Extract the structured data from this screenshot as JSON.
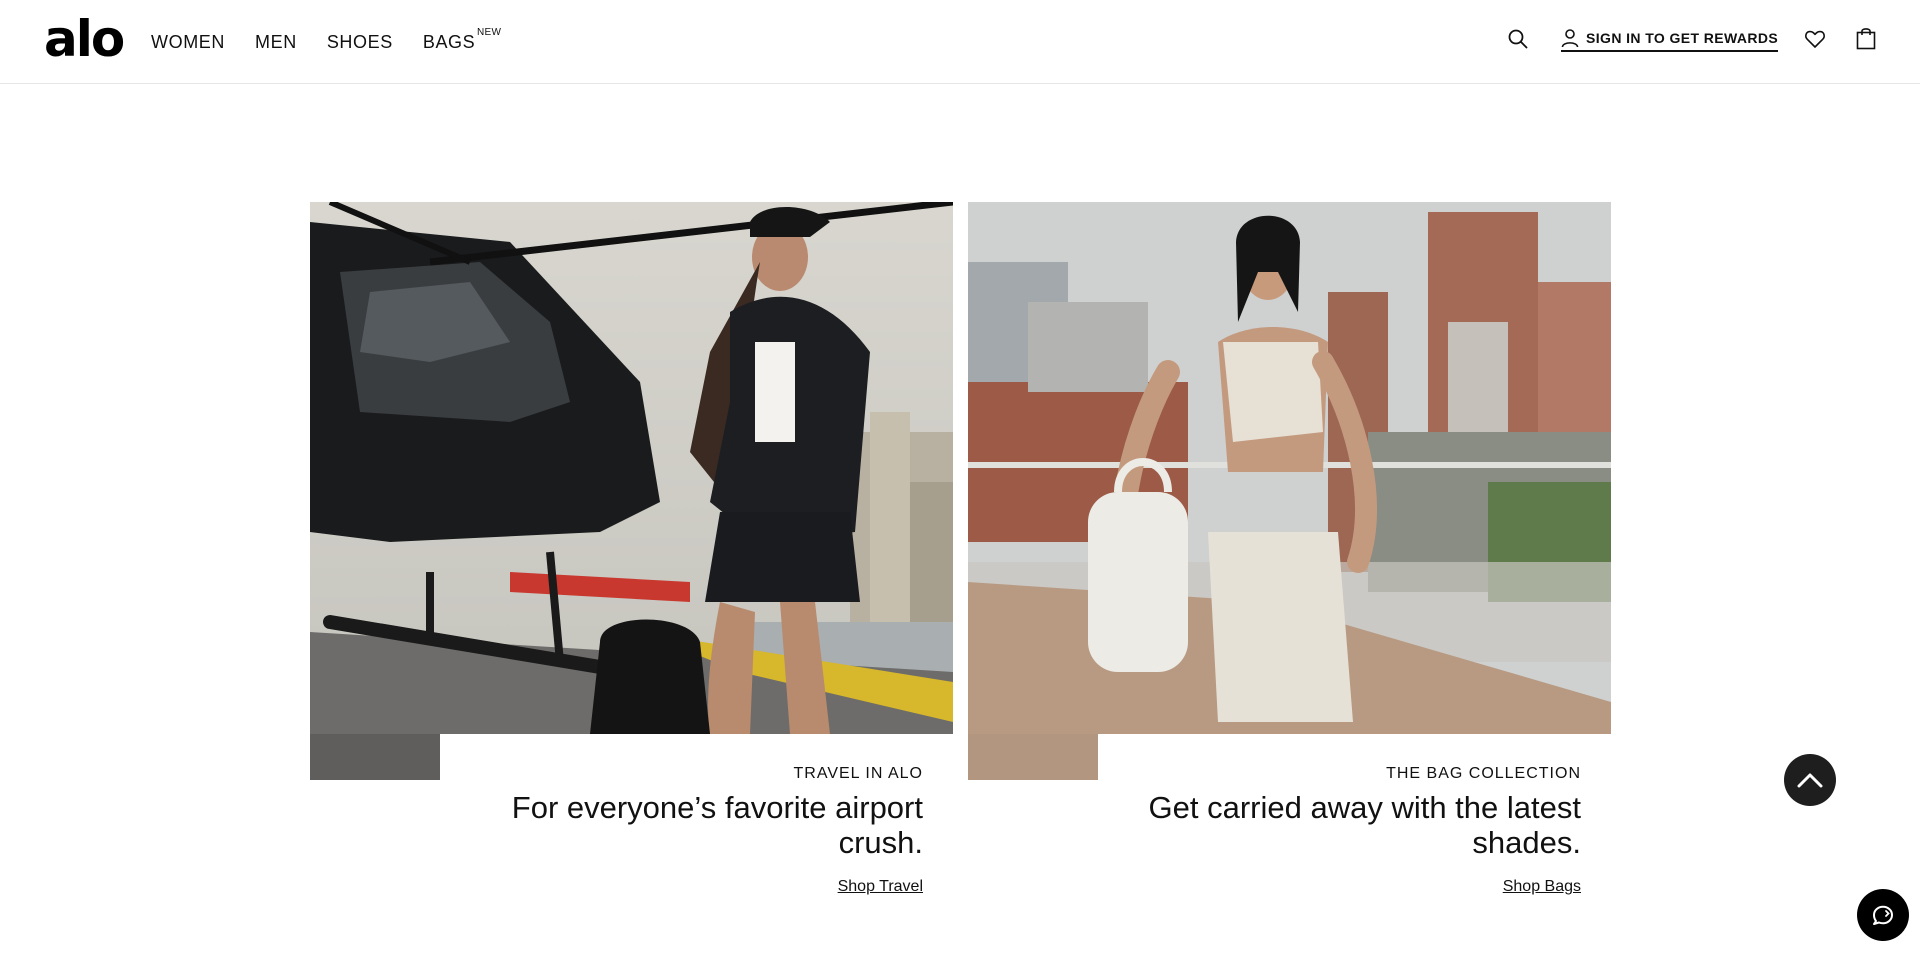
{
  "header": {
    "logo": "alo",
    "nav": [
      {
        "label": "WOMEN"
      },
      {
        "label": "MEN"
      },
      {
        "label": "SHOES"
      },
      {
        "label": "BAGS",
        "badge": "NEW"
      }
    ],
    "icons": {
      "search": "search-icon",
      "account": "user-icon",
      "wishlist": "heart-icon",
      "cart": "shopping-bag-icon"
    },
    "signin_label": "SIGN IN TO GET REWARDS"
  },
  "cards": [
    {
      "eyebrow": "TRAVEL IN ALO",
      "headline_line1": "For everyone’s favorite airport",
      "headline_line2": "crush.",
      "cta": "Shop Travel",
      "image_desc": "woman-with-helicopter"
    },
    {
      "eyebrow": "THE BAG COLLECTION",
      "headline_line1": "Get carried away with the latest",
      "headline_line2": "shades.",
      "cta": "Shop Bags",
      "image_desc": "woman-with-white-bag-rooftop"
    }
  ],
  "floating": {
    "scroll_top_icon": "chevron-up-icon",
    "chat_icon": "chat-icon"
  },
  "colors": {
    "text": "#111111",
    "border": "#e6e6e6",
    "button_dark": "#1e1e1e"
  }
}
